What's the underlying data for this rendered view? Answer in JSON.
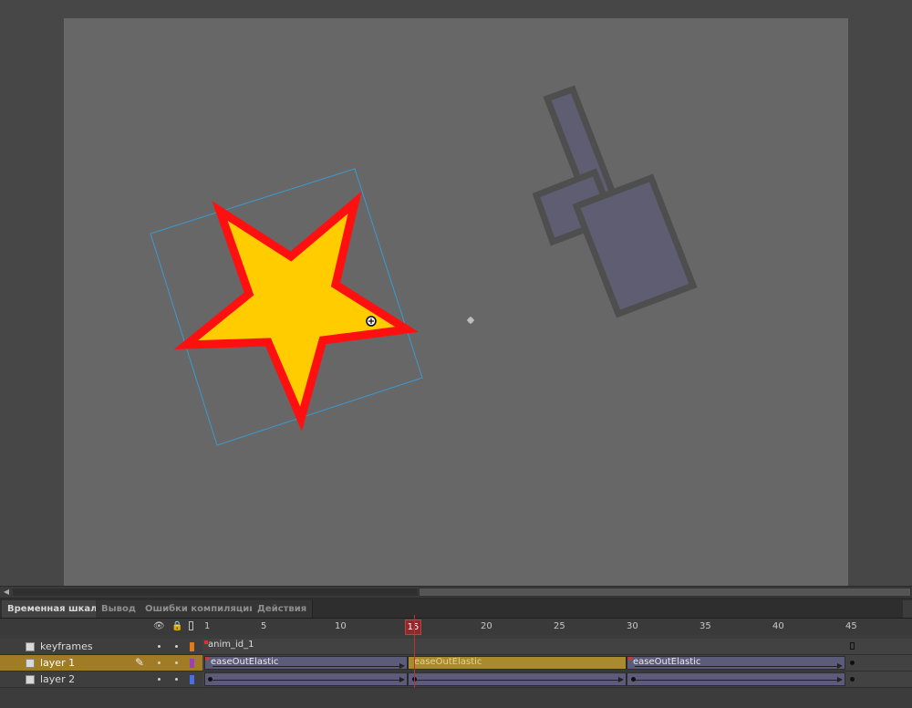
{
  "panel": {
    "tabs": [
      {
        "label": "Временная шкала",
        "active": true
      },
      {
        "label": "Вывод",
        "active": false
      },
      {
        "label": "Ошибки компиляции",
        "active": false
      },
      {
        "label": "Действия",
        "active": false
      }
    ]
  },
  "timeline": {
    "ruler": [
      "1",
      "5",
      "10",
      "15",
      "20",
      "25",
      "30",
      "35",
      "40",
      "45"
    ],
    "current_frame": "15",
    "layers": [
      {
        "name": "keyframes",
        "color": "#e07a1a",
        "frame_label": "anim_id_1"
      },
      {
        "name": "layer 1",
        "color": "#9b3fbf",
        "selected": true,
        "tweens": [
          {
            "label": "easeOutElastic"
          },
          {
            "label": "easeOutElastic"
          },
          {
            "label": "easeOutElastic"
          }
        ]
      },
      {
        "name": "layer 2",
        "color": "#4a6fe0"
      }
    ]
  },
  "stage": {
    "star_fill": "#ffcc00",
    "star_stroke": "#ff1010",
    "shape_fill": "#5e5d72",
    "shape_stroke": "#4e4e4e",
    "bbox_color": "#3a9ad0"
  },
  "icons": [
    "eye-icon",
    "lock-icon",
    "outline-icon",
    "pencil-icon",
    "layer-icon",
    "crosshair-icon",
    "registration-point-icon"
  ]
}
